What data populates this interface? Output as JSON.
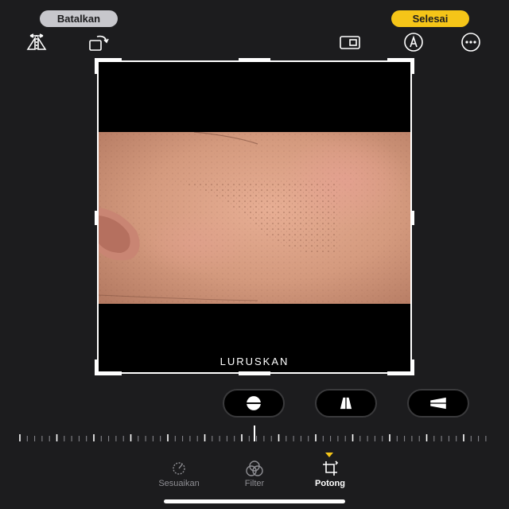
{
  "header": {
    "cancel_label": "Batalkan",
    "done_label": "Selesai"
  },
  "toolbar": {
    "left_icons": [
      "flip-horizontal-icon",
      "rotate-icon"
    ],
    "right_icons": [
      "aspect-ratio-icon",
      "markup-pen-icon",
      "more-options-icon"
    ]
  },
  "editor": {
    "straighten_label": "LURUSKAN"
  },
  "perspective_controls": [
    "straighten-icon",
    "vertical-perspective-icon",
    "horizontal-perspective-icon"
  ],
  "tabs": [
    {
      "label": "Sesuaikan",
      "icon": "adjust-dial-icon",
      "active": false
    },
    {
      "label": "Filter",
      "icon": "filter-circles-icon",
      "active": false
    },
    {
      "label": "Potong",
      "icon": "crop-icon",
      "active": true
    }
  ],
  "colors": {
    "accent": "#f5c518",
    "background": "#1c1c1e"
  }
}
